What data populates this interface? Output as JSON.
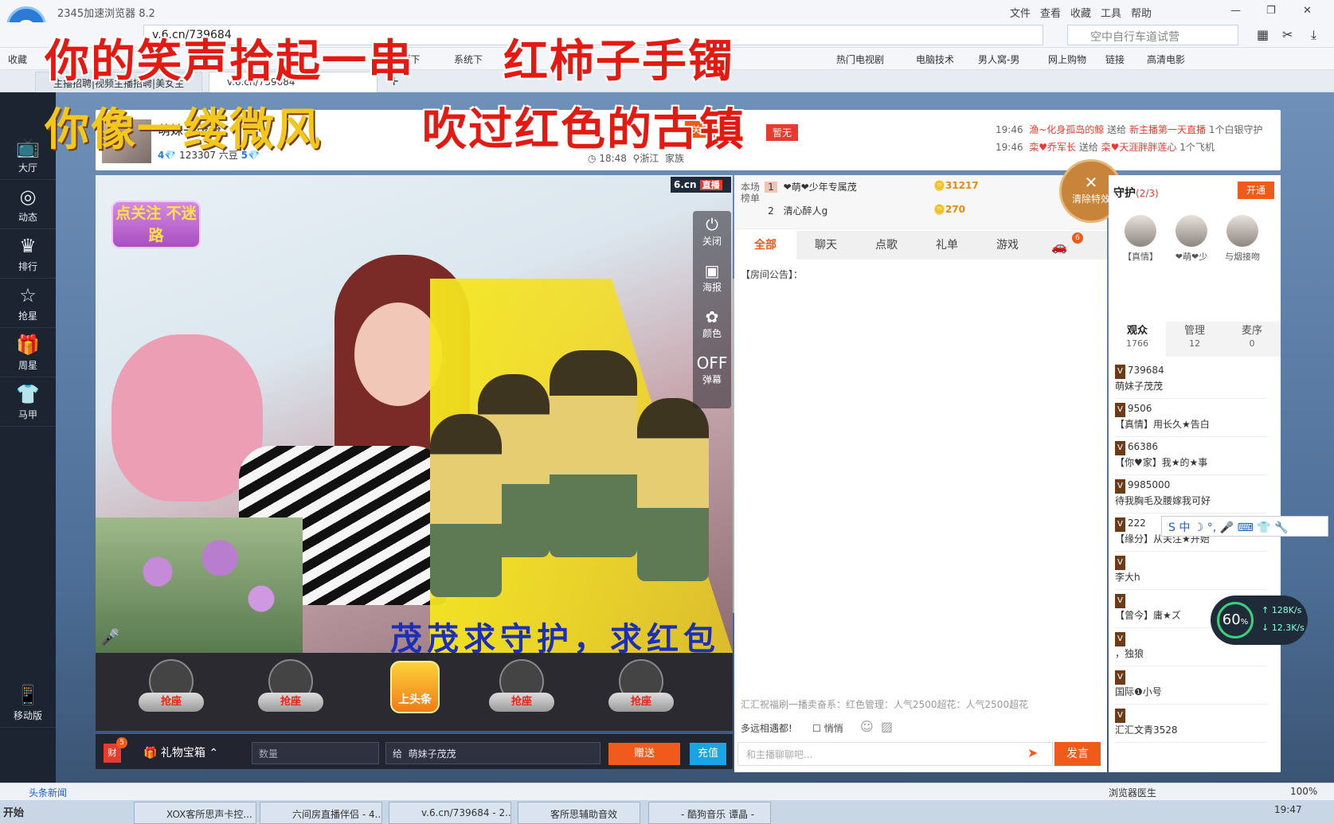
{
  "browser": {
    "app_title": "2345加速浏览器 8.2",
    "menu": [
      "文件",
      "查看",
      "收藏",
      "工具",
      "帮助"
    ],
    "address": "v.6.cn/739684",
    "search_placeholder": "空中自行车道试营",
    "favorites": [
      "收藏",
      "XP主题下",
      "系统下",
      "热门电视剧",
      "电脑技术",
      "男人窝-男",
      "网上购物",
      "链接",
      "高清电影"
    ],
    "tabs": [
      "主播招聘|视频主播招聘|美女主",
      "v.6.cn/739684"
    ],
    "new_tab": "+"
  },
  "overlay": {
    "line1_a": "你的笑声拾起一串",
    "line1_b": "红柿子手镯",
    "line2_a": "你像一缕微风",
    "line2_b": "吹过红色的古镇"
  },
  "leftnav": [
    {
      "icon": "tv-icon",
      "glyph": "📺",
      "label": "大厅"
    },
    {
      "icon": "compass-icon",
      "glyph": "◎",
      "label": "动态"
    },
    {
      "icon": "crown-icon",
      "glyph": "♛",
      "label": "排行"
    },
    {
      "icon": "star-icon",
      "glyph": "☆",
      "label": "抢星"
    },
    {
      "icon": "gift-icon",
      "glyph": "🎁",
      "label": "周星"
    },
    {
      "icon": "shirt-icon",
      "glyph": "👕",
      "label": "马甲"
    },
    {
      "icon": "mobile-icon",
      "glyph": "📱",
      "label": "移动版"
    }
  ],
  "host": {
    "name": "萌妹子茂茂",
    "level": "4",
    "beans": "123307 六豆",
    "level2": "5",
    "time": "18:48",
    "location": "浙江",
    "family": "家族",
    "follow_label": "关注",
    "no_label": "暂无"
  },
  "header_feed": [
    {
      "time": "19:46",
      "from": "渔~化身孤岛的鲸",
      "verb": "送给",
      "to": "新主播第一天直播",
      "gift": "1个白银守护"
    },
    {
      "time": "19:46",
      "from": "栾♥乔军长",
      "verb": "送给",
      "to": "栾♥天涯胖胖莲心",
      "gift": "1个飞机"
    }
  ],
  "video": {
    "brand": "6.cn",
    "live": "直播",
    "follow_sticker": "点关注 不迷路",
    "controls": [
      {
        "icon": "power-icon",
        "glyph": "⏻",
        "label": "关闭"
      },
      {
        "icon": "poster-icon",
        "glyph": "▣",
        "label": "海报"
      },
      {
        "icon": "color-icon",
        "glyph": "✿",
        "label": "颜色"
      },
      {
        "icon": "danmaku-icon",
        "glyph": "OFF",
        "label": "弹幕"
      }
    ],
    "subtitle": "茂茂求守护，求红包",
    "seat_label": "抢座",
    "toutiao": "上头条"
  },
  "giftbar": {
    "treasure_badge": "5",
    "treasure_label": "礼物宝箱",
    "qty_placeholder": "数量",
    "to_label": "给",
    "to_name": "萌妹子茂茂",
    "send": "赠送",
    "charge": "充值"
  },
  "rank": {
    "title": "本场榜单",
    "rows": [
      {
        "n": "1",
        "name": "❤萌❤少年专属茂",
        "value": "31217"
      },
      {
        "n": "2",
        "name": "清心醉人g",
        "value": "270"
      }
    ]
  },
  "chat": {
    "tabs": [
      "全部",
      "聊天",
      "点歌",
      "礼单",
      "游戏"
    ],
    "car_badge": "6",
    "notice": "【房间公告】：",
    "clear_fx": "清除特效",
    "broadcast": "汇汇祝福刷一播卖奋系：红色管理：人气2500超花：人气2500超花",
    "to_all": "多远相遇都!",
    "whisper": "悄悄",
    "input_placeholder": "和主播聊聊吧...",
    "send": "发言"
  },
  "guard": {
    "title": "守护",
    "count": "(2/3)",
    "open": "开通",
    "members": [
      "【真情】",
      "❤萌❤少",
      "与烟接吻"
    ]
  },
  "audience_tabs": [
    {
      "label": "观众",
      "count": "1766"
    },
    {
      "label": "管理",
      "count": "12"
    },
    {
      "label": "麦序",
      "count": "0"
    }
  ],
  "audience": [
    {
      "id": "739684",
      "name": "萌妹子茂茂"
    },
    {
      "id": "9506",
      "name": "【真情】用长久★告白"
    },
    {
      "id": "66386",
      "name": "【你♥家】我★的★事"
    },
    {
      "id": "9985000",
      "name": "待我胸毛及腰嫁我可好"
    },
    {
      "id": "222",
      "name": "【缘分】从关注★开始"
    },
    {
      "id": "",
      "name": "李大h"
    },
    {
      "id": "",
      "name": "【曾今】庸★ズ"
    },
    {
      "id": "",
      "name": "，独狼"
    },
    {
      "id": "",
      "name": "国际❶小号"
    },
    {
      "id": "",
      "name": "汇汇文青3528"
    }
  ],
  "speed": {
    "pct": "60",
    "unit": "%",
    "up": "128K/s",
    "down": "12.3K/s"
  },
  "status": {
    "news": "头条新闻",
    "doctor": "浏览器医生",
    "zoom": "100%"
  },
  "taskbar": {
    "start": "开始",
    "tasks": [
      "XOX客所思声卡控...",
      "六间房直播伴侣 - 4....",
      "v.6.cn/739684 - 2...",
      "客所思辅助音效",
      "- 酷狗音乐 谭晶 -"
    ],
    "clock": "19:47"
  },
  "colors": {
    "accent": "#f05a1a",
    "nav": "#1b2430",
    "overlay_red": "#e31a12",
    "overlay_yellow": "#f2c81a"
  }
}
